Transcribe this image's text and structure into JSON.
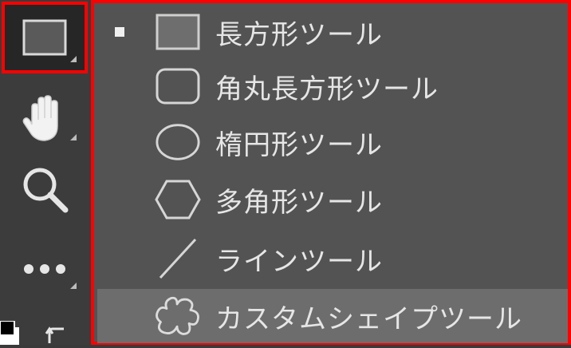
{
  "toolbar": {
    "tools": [
      {
        "name": "rectangle-tool",
        "icon": "rectangle-icon",
        "active": true,
        "has_flyout": true
      },
      {
        "name": "hand-tool",
        "icon": "hand-icon",
        "active": false,
        "has_flyout": true
      },
      {
        "name": "zoom-tool",
        "icon": "magnifier-icon",
        "active": false,
        "has_flyout": false
      },
      {
        "name": "more-tools",
        "icon": "ellipsis-icon",
        "active": false,
        "has_flyout": true
      }
    ]
  },
  "shape_menu": {
    "items": [
      {
        "label": "長方形ツール",
        "icon": "rectangle-icon",
        "selected": true,
        "hovered": false
      },
      {
        "label": "角丸長方形ツール",
        "icon": "rounded-rectangle-icon",
        "selected": false,
        "hovered": false
      },
      {
        "label": "楕円形ツール",
        "icon": "ellipse-icon",
        "selected": false,
        "hovered": false
      },
      {
        "label": "多角形ツール",
        "icon": "polygon-icon",
        "selected": false,
        "hovered": false
      },
      {
        "label": "ラインツール",
        "icon": "line-icon",
        "selected": false,
        "hovered": false
      },
      {
        "label": "カスタムシェイプツール",
        "icon": "custom-shape-icon",
        "selected": false,
        "hovered": true
      }
    ]
  },
  "colors": {
    "highlight_border": "#ff0000",
    "menu_bg": "#535353",
    "hover_bg": "#6d6d6d",
    "text": "#e6e6e6"
  }
}
